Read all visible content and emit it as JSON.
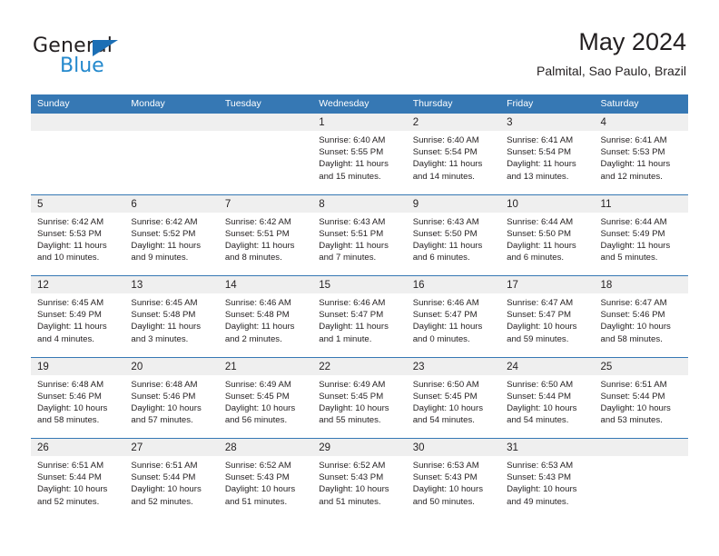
{
  "brand": {
    "name_part1": "General",
    "name_part2": "Blue",
    "logo_icon": "triangle-logo-icon"
  },
  "header": {
    "title": "May 2024",
    "subtitle": "Palmital, Sao Paulo, Brazil"
  },
  "calendar": {
    "weekday_headers": [
      "Sunday",
      "Monday",
      "Tuesday",
      "Wednesday",
      "Thursday",
      "Friday",
      "Saturday"
    ],
    "accent_color": "#3678b4",
    "daynum_band_color": "#efefef",
    "weeks": [
      [
        {
          "day": "",
          "lines": []
        },
        {
          "day": "",
          "lines": []
        },
        {
          "day": "",
          "lines": []
        },
        {
          "day": "1",
          "lines": [
            "Sunrise: 6:40 AM",
            "Sunset: 5:55 PM",
            "Daylight: 11 hours",
            "and 15 minutes."
          ]
        },
        {
          "day": "2",
          "lines": [
            "Sunrise: 6:40 AM",
            "Sunset: 5:54 PM",
            "Daylight: 11 hours",
            "and 14 minutes."
          ]
        },
        {
          "day": "3",
          "lines": [
            "Sunrise: 6:41 AM",
            "Sunset: 5:54 PM",
            "Daylight: 11 hours",
            "and 13 minutes."
          ]
        },
        {
          "day": "4",
          "lines": [
            "Sunrise: 6:41 AM",
            "Sunset: 5:53 PM",
            "Daylight: 11 hours",
            "and 12 minutes."
          ]
        }
      ],
      [
        {
          "day": "5",
          "lines": [
            "Sunrise: 6:42 AM",
            "Sunset: 5:53 PM",
            "Daylight: 11 hours",
            "and 10 minutes."
          ]
        },
        {
          "day": "6",
          "lines": [
            "Sunrise: 6:42 AM",
            "Sunset: 5:52 PM",
            "Daylight: 11 hours",
            "and 9 minutes."
          ]
        },
        {
          "day": "7",
          "lines": [
            "Sunrise: 6:42 AM",
            "Sunset: 5:51 PM",
            "Daylight: 11 hours",
            "and 8 minutes."
          ]
        },
        {
          "day": "8",
          "lines": [
            "Sunrise: 6:43 AM",
            "Sunset: 5:51 PM",
            "Daylight: 11 hours",
            "and 7 minutes."
          ]
        },
        {
          "day": "9",
          "lines": [
            "Sunrise: 6:43 AM",
            "Sunset: 5:50 PM",
            "Daylight: 11 hours",
            "and 6 minutes."
          ]
        },
        {
          "day": "10",
          "lines": [
            "Sunrise: 6:44 AM",
            "Sunset: 5:50 PM",
            "Daylight: 11 hours",
            "and 6 minutes."
          ]
        },
        {
          "day": "11",
          "lines": [
            "Sunrise: 6:44 AM",
            "Sunset: 5:49 PM",
            "Daylight: 11 hours",
            "and 5 minutes."
          ]
        }
      ],
      [
        {
          "day": "12",
          "lines": [
            "Sunrise: 6:45 AM",
            "Sunset: 5:49 PM",
            "Daylight: 11 hours",
            "and 4 minutes."
          ]
        },
        {
          "day": "13",
          "lines": [
            "Sunrise: 6:45 AM",
            "Sunset: 5:48 PM",
            "Daylight: 11 hours",
            "and 3 minutes."
          ]
        },
        {
          "day": "14",
          "lines": [
            "Sunrise: 6:46 AM",
            "Sunset: 5:48 PM",
            "Daylight: 11 hours",
            "and 2 minutes."
          ]
        },
        {
          "day": "15",
          "lines": [
            "Sunrise: 6:46 AM",
            "Sunset: 5:47 PM",
            "Daylight: 11 hours",
            "and 1 minute."
          ]
        },
        {
          "day": "16",
          "lines": [
            "Sunrise: 6:46 AM",
            "Sunset: 5:47 PM",
            "Daylight: 11 hours",
            "and 0 minutes."
          ]
        },
        {
          "day": "17",
          "lines": [
            "Sunrise: 6:47 AM",
            "Sunset: 5:47 PM",
            "Daylight: 10 hours",
            "and 59 minutes."
          ]
        },
        {
          "day": "18",
          "lines": [
            "Sunrise: 6:47 AM",
            "Sunset: 5:46 PM",
            "Daylight: 10 hours",
            "and 58 minutes."
          ]
        }
      ],
      [
        {
          "day": "19",
          "lines": [
            "Sunrise: 6:48 AM",
            "Sunset: 5:46 PM",
            "Daylight: 10 hours",
            "and 58 minutes."
          ]
        },
        {
          "day": "20",
          "lines": [
            "Sunrise: 6:48 AM",
            "Sunset: 5:46 PM",
            "Daylight: 10 hours",
            "and 57 minutes."
          ]
        },
        {
          "day": "21",
          "lines": [
            "Sunrise: 6:49 AM",
            "Sunset: 5:45 PM",
            "Daylight: 10 hours",
            "and 56 minutes."
          ]
        },
        {
          "day": "22",
          "lines": [
            "Sunrise: 6:49 AM",
            "Sunset: 5:45 PM",
            "Daylight: 10 hours",
            "and 55 minutes."
          ]
        },
        {
          "day": "23",
          "lines": [
            "Sunrise: 6:50 AM",
            "Sunset: 5:45 PM",
            "Daylight: 10 hours",
            "and 54 minutes."
          ]
        },
        {
          "day": "24",
          "lines": [
            "Sunrise: 6:50 AM",
            "Sunset: 5:44 PM",
            "Daylight: 10 hours",
            "and 54 minutes."
          ]
        },
        {
          "day": "25",
          "lines": [
            "Sunrise: 6:51 AM",
            "Sunset: 5:44 PM",
            "Daylight: 10 hours",
            "and 53 minutes."
          ]
        }
      ],
      [
        {
          "day": "26",
          "lines": [
            "Sunrise: 6:51 AM",
            "Sunset: 5:44 PM",
            "Daylight: 10 hours",
            "and 52 minutes."
          ]
        },
        {
          "day": "27",
          "lines": [
            "Sunrise: 6:51 AM",
            "Sunset: 5:44 PM",
            "Daylight: 10 hours",
            "and 52 minutes."
          ]
        },
        {
          "day": "28",
          "lines": [
            "Sunrise: 6:52 AM",
            "Sunset: 5:43 PM",
            "Daylight: 10 hours",
            "and 51 minutes."
          ]
        },
        {
          "day": "29",
          "lines": [
            "Sunrise: 6:52 AM",
            "Sunset: 5:43 PM",
            "Daylight: 10 hours",
            "and 51 minutes."
          ]
        },
        {
          "day": "30",
          "lines": [
            "Sunrise: 6:53 AM",
            "Sunset: 5:43 PM",
            "Daylight: 10 hours",
            "and 50 minutes."
          ]
        },
        {
          "day": "31",
          "lines": [
            "Sunrise: 6:53 AM",
            "Sunset: 5:43 PM",
            "Daylight: 10 hours",
            "and 49 minutes."
          ]
        },
        {
          "day": "",
          "lines": []
        }
      ]
    ]
  }
}
